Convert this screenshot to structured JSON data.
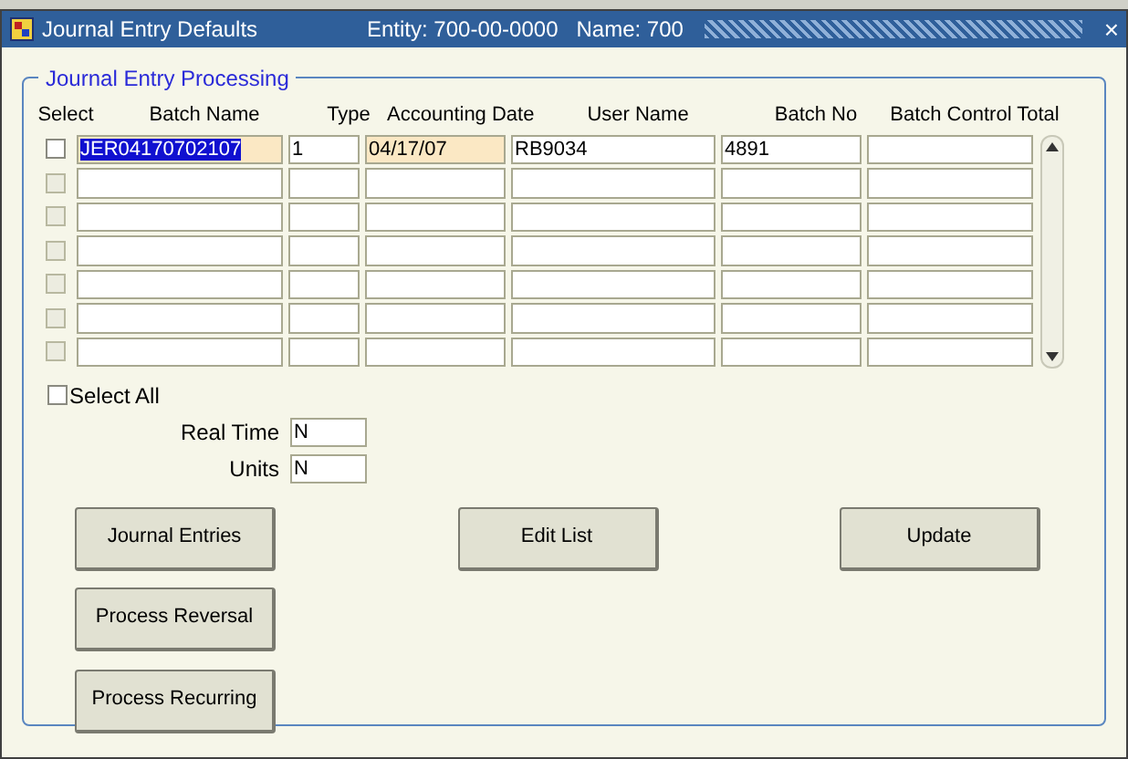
{
  "window": {
    "title": "Journal Entry Defaults",
    "entity": "Entity: 700-00-0000",
    "name": "Name: 700",
    "close": "×"
  },
  "group": {
    "title": "Journal Entry Processing"
  },
  "columns": [
    "Select",
    "Batch Name",
    "Type",
    "Accounting Date",
    "User Name",
    "Batch No",
    "Batch Control Total"
  ],
  "rows": [
    {
      "checked": false,
      "disabled": false,
      "current": true,
      "batch_name": "JER04170702107",
      "type": "1",
      "accounting_date": "04/17/07",
      "user_name": "RB9034",
      "batch_no": "4891"
    },
    {
      "checked": false,
      "disabled": true,
      "current": false
    },
    {
      "checked": false,
      "disabled": true,
      "current": false
    },
    {
      "checked": false,
      "disabled": true,
      "current": false
    },
    {
      "checked": false,
      "disabled": true,
      "current": false
    },
    {
      "checked": false,
      "disabled": true,
      "current": false
    },
    {
      "checked": false,
      "disabled": true,
      "current": false
    }
  ],
  "select_all": {
    "label": "Select All",
    "checked": false
  },
  "fields": [
    {
      "label": "Real Time",
      "value": "N"
    },
    {
      "label": "Units",
      "value": "N"
    }
  ],
  "buttons": [
    {
      "label": "Journal Entries"
    },
    {
      "label": "Edit List"
    },
    {
      "label": "Update"
    },
    {
      "label": "Process Reversal"
    },
    {
      "label": "Process Recurring"
    }
  ]
}
